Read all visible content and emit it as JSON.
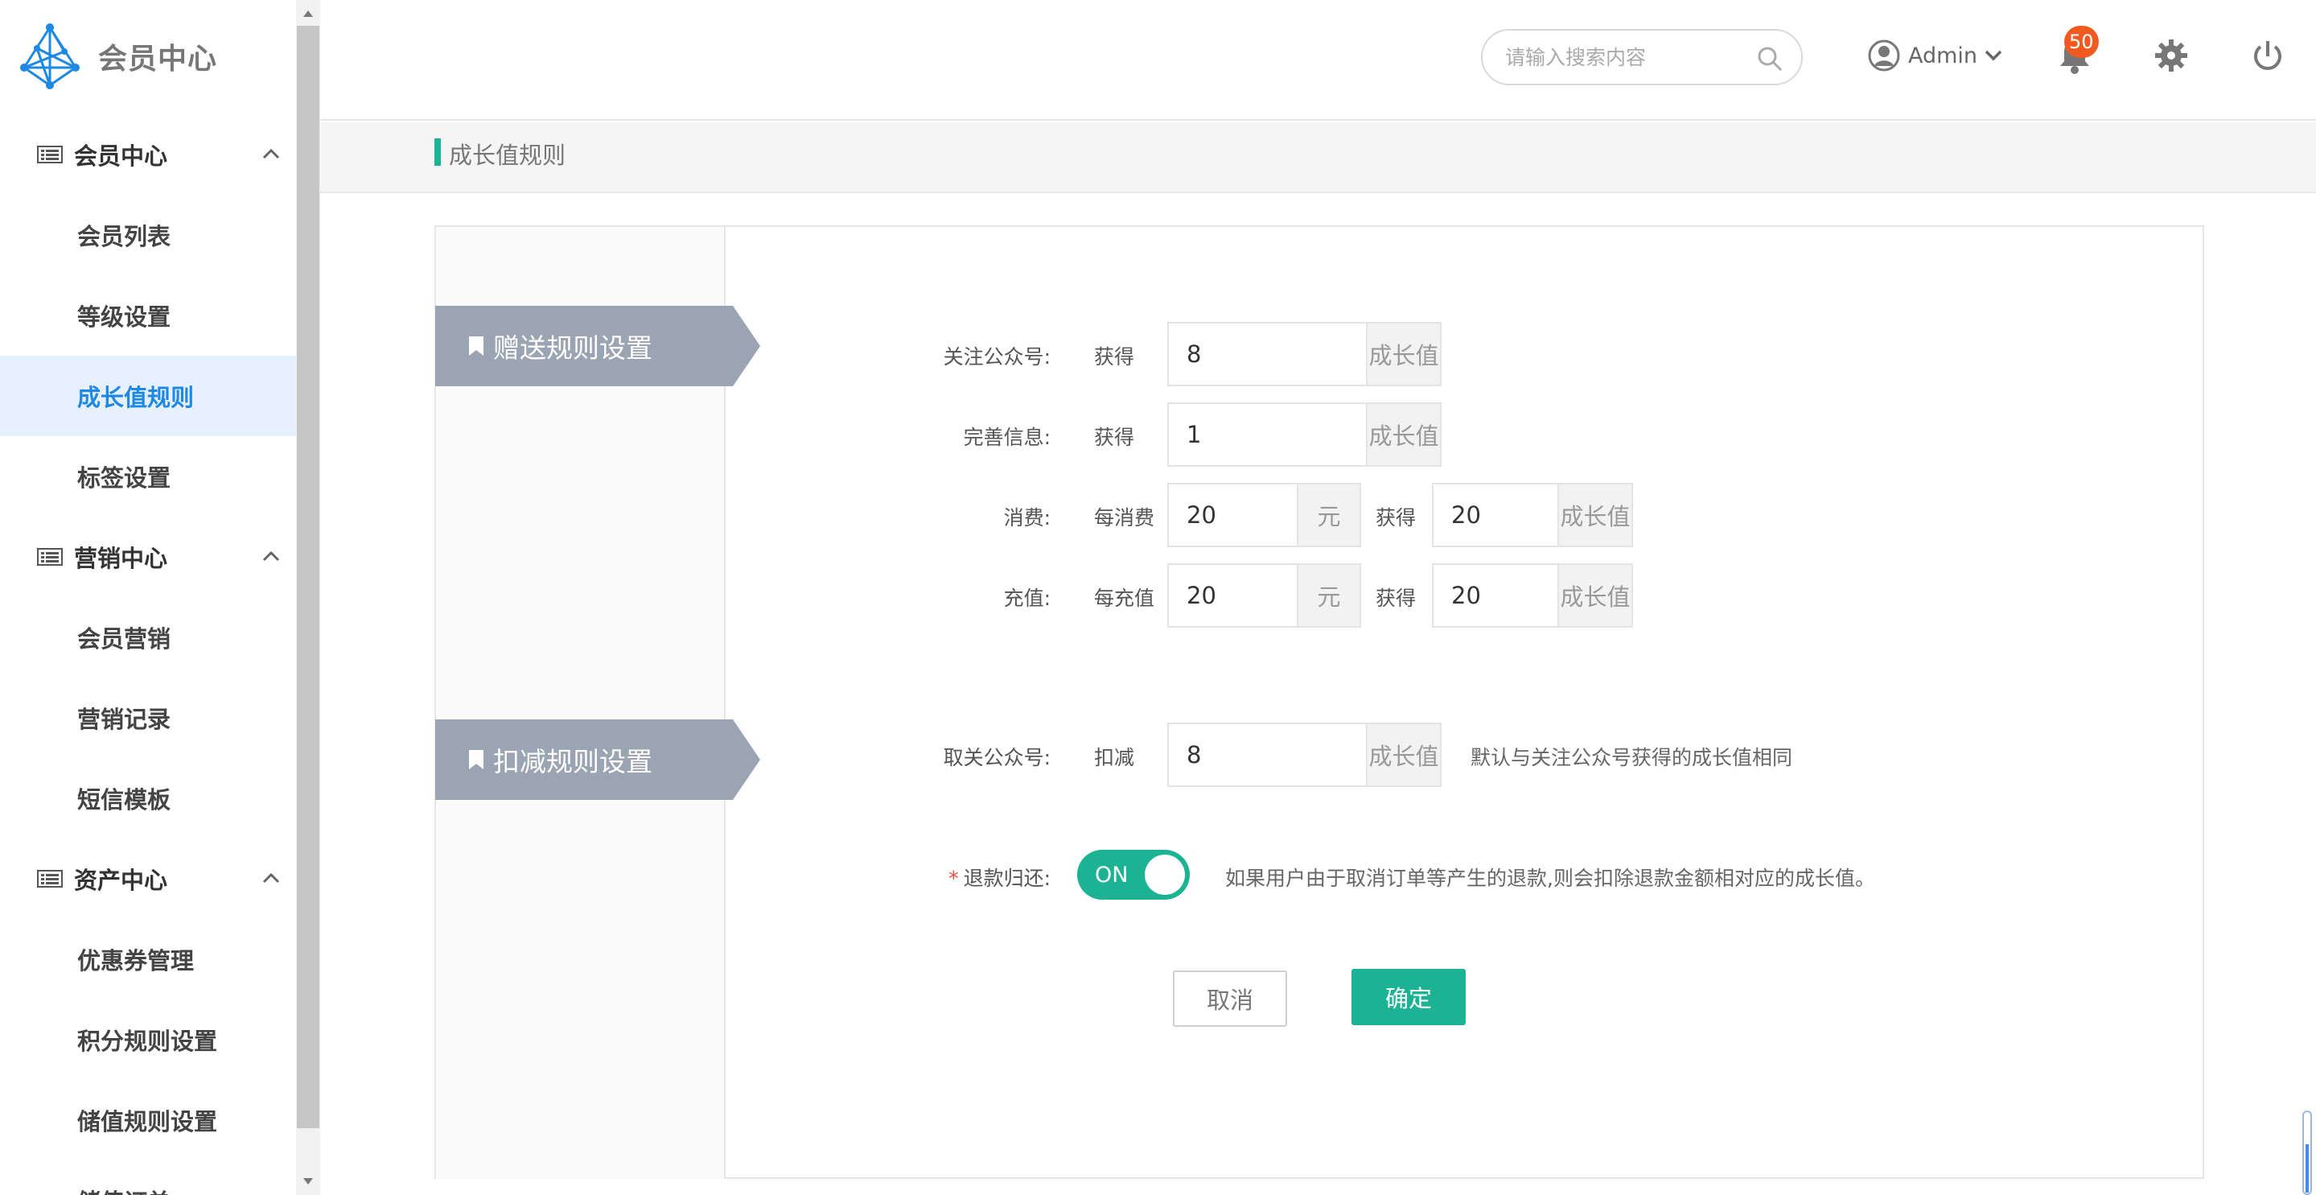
{
  "brand": {
    "name": "会员中心"
  },
  "sidebar": {
    "groups": [
      {
        "label": "会员中心",
        "items": [
          "会员列表",
          "等级设置",
          "成长值规则",
          "标签设置"
        ]
      },
      {
        "label": "营销中心",
        "items": [
          "会员营销",
          "营销记录",
          "短信模板"
        ]
      },
      {
        "label": "资产中心",
        "items": [
          "优惠券管理",
          "积分规则设置",
          "储值规则设置",
          "储值订单"
        ]
      }
    ],
    "active_item": "成长值规则"
  },
  "header": {
    "search_placeholder": "请输入搜索内容",
    "user_name": "Admin",
    "notification_count": "50"
  },
  "breadcrumb": {
    "title": "成长值规则"
  },
  "gift_section": {
    "title": "赠送规则设置",
    "rows": [
      {
        "label": "关注公众号:",
        "prefix": "获得",
        "value": "8",
        "unit": "成长值"
      },
      {
        "label": "完善信息:",
        "prefix": "获得",
        "value": "1",
        "unit": "成长值"
      },
      {
        "label": "消费:",
        "prefix": "每消费",
        "value": "20",
        "unit": "元",
        "prefix2": "获得",
        "value2": "20",
        "unit2": "成长值"
      },
      {
        "label": "充值:",
        "prefix": "每充值",
        "value": "20",
        "unit": "元",
        "prefix2": "获得",
        "value2": "20",
        "unit2": "成长值"
      }
    ]
  },
  "deduct_section": {
    "title": "扣减规则设置",
    "unfollow": {
      "label": "取关公众号:",
      "prefix": "扣减",
      "value": "8",
      "unit": "成长值",
      "hint": "默认与关注公众号获得的成长值相同"
    },
    "refund": {
      "required_mark": "*",
      "label": "退款归还:",
      "toggle": "ON",
      "hint": "如果用户由于取消订单等产生的退款,则会扣除退款金额相对应的成长值。"
    }
  },
  "actions": {
    "cancel": "取消",
    "confirm": "确定"
  },
  "colors": {
    "accent": "#1cb394",
    "active_bg": "#e6f1fd",
    "active_text": "#1e88e5",
    "ribbon": "#9aa4b2",
    "badge": "#f05a1f"
  }
}
